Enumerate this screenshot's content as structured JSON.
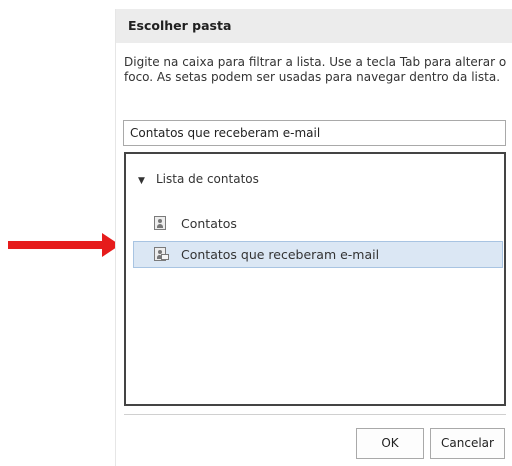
{
  "dialog": {
    "title": "Escolher pasta",
    "instructions": "Digite na caixa para filtrar a lista. Use a tecla Tab para alterar o foco. As setas podem ser usadas para navegar dentro da lista.",
    "filter_value": "Contatos que receberam e-mail",
    "tree": {
      "root_label": "Lista de contatos",
      "root_caret": "▼",
      "items": [
        {
          "label": "Contatos",
          "icon": "contact-card-icon",
          "selected": false
        },
        {
          "label": "Contatos que receberam e-mail",
          "icon": "contact-mail-icon",
          "selected": true
        }
      ]
    },
    "buttons": {
      "ok": "OK",
      "cancel": "Cancelar"
    }
  },
  "annotation": {
    "arrow_color": "#e61c1c"
  },
  "colors": {
    "title_bar": "#ececec",
    "selection_background": "#dbe7f4",
    "selection_border": "#a8c4e2"
  }
}
